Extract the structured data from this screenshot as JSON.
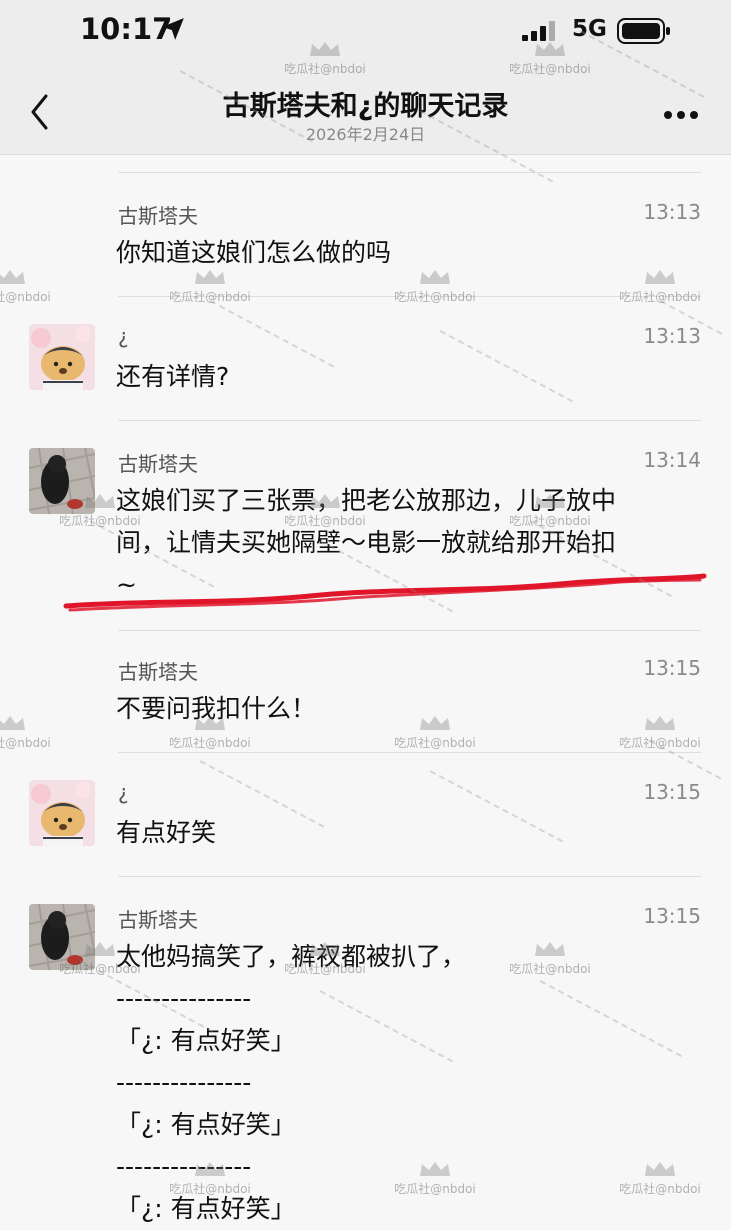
{
  "status_bar": {
    "time": "10:17",
    "network": "5G"
  },
  "header": {
    "title": "古斯塔夫和¿的聊天记录",
    "date": "2026年2月24日"
  },
  "watermark": "吃瓜社@nbdoi",
  "messages": [
    {
      "sender": "古斯塔夫",
      "time": "13:13",
      "text": "你知道这娘们怎么做的吗"
    },
    {
      "sender": "¿",
      "time": "13:13",
      "text": "还有详情?"
    },
    {
      "sender": "古斯塔夫",
      "time": "13:14",
      "lines": [
        "这娘们买了三张票，把老公放那边，儿子放中",
        "间，让情夫买她隔壁～电影一放就给那开始扣",
        "~"
      ]
    },
    {
      "sender": "古斯塔夫",
      "time": "13:15",
      "text": "不要问我扣什么！"
    },
    {
      "sender": "¿",
      "time": "13:15",
      "text": "有点好笑"
    },
    {
      "sender": "古斯塔夫",
      "time": "13:15",
      "lines": [
        "太他妈搞笑了，裤衩都被扒了，",
        "---------------",
        "「¿: 有点好笑」",
        "---------------",
        "「¿: 有点好笑」",
        "---------------",
        "「¿: 有点好笑」"
      ]
    }
  ],
  "colors": {
    "annotation_underline": "#e0152a"
  }
}
